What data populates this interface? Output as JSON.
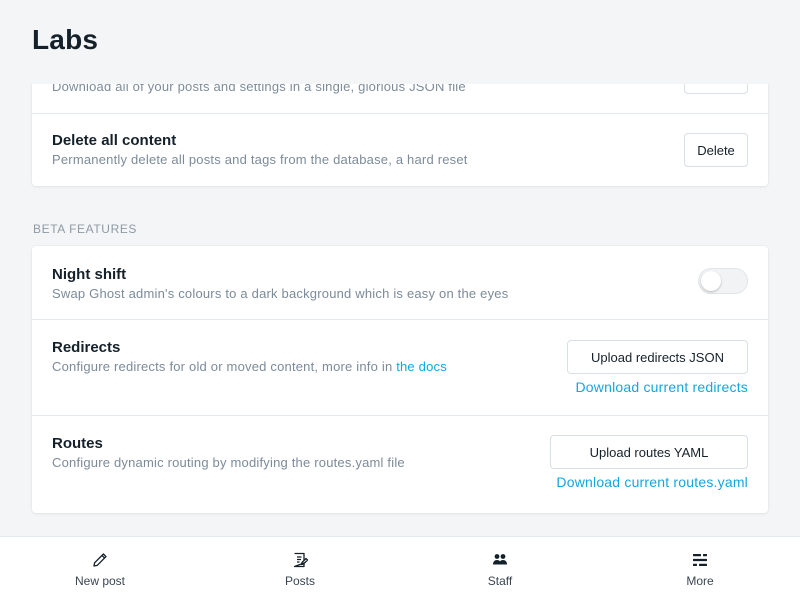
{
  "page": {
    "title": "Labs"
  },
  "export": {
    "description": "Download all of your posts and settings in a single, glorious JSON file"
  },
  "delete_content": {
    "title": "Delete all content",
    "description": "Permanently delete all posts and tags from the database, a hard reset",
    "button_label": "Delete"
  },
  "beta_section": {
    "label": "BETA FEATURES"
  },
  "night_shift": {
    "title": "Night shift",
    "description": "Swap Ghost admin's colours to a dark background which is easy on the eyes",
    "enabled": false
  },
  "redirects": {
    "title": "Redirects",
    "description": "Configure redirects for old or moved content, more info in ",
    "docs_link": "the docs",
    "upload_label": "Upload redirects JSON",
    "download_label": "Download current redirects"
  },
  "routes": {
    "title": "Routes",
    "description": "Configure dynamic routing by modifying the routes.yaml file",
    "upload_label": "Upload routes YAML",
    "download_label": "Download current routes.yaml"
  },
  "nav": {
    "items": [
      {
        "label": "New post",
        "icon": "pencil-icon"
      },
      {
        "label": "Posts",
        "icon": "posts-icon"
      },
      {
        "label": "Staff",
        "icon": "staff-icon"
      },
      {
        "label": "More",
        "icon": "more-icon"
      }
    ]
  },
  "colors": {
    "accent": "#14a6e0",
    "text": "#15212a",
    "muted": "#7c8b9a",
    "background": "#f4f5f6"
  }
}
